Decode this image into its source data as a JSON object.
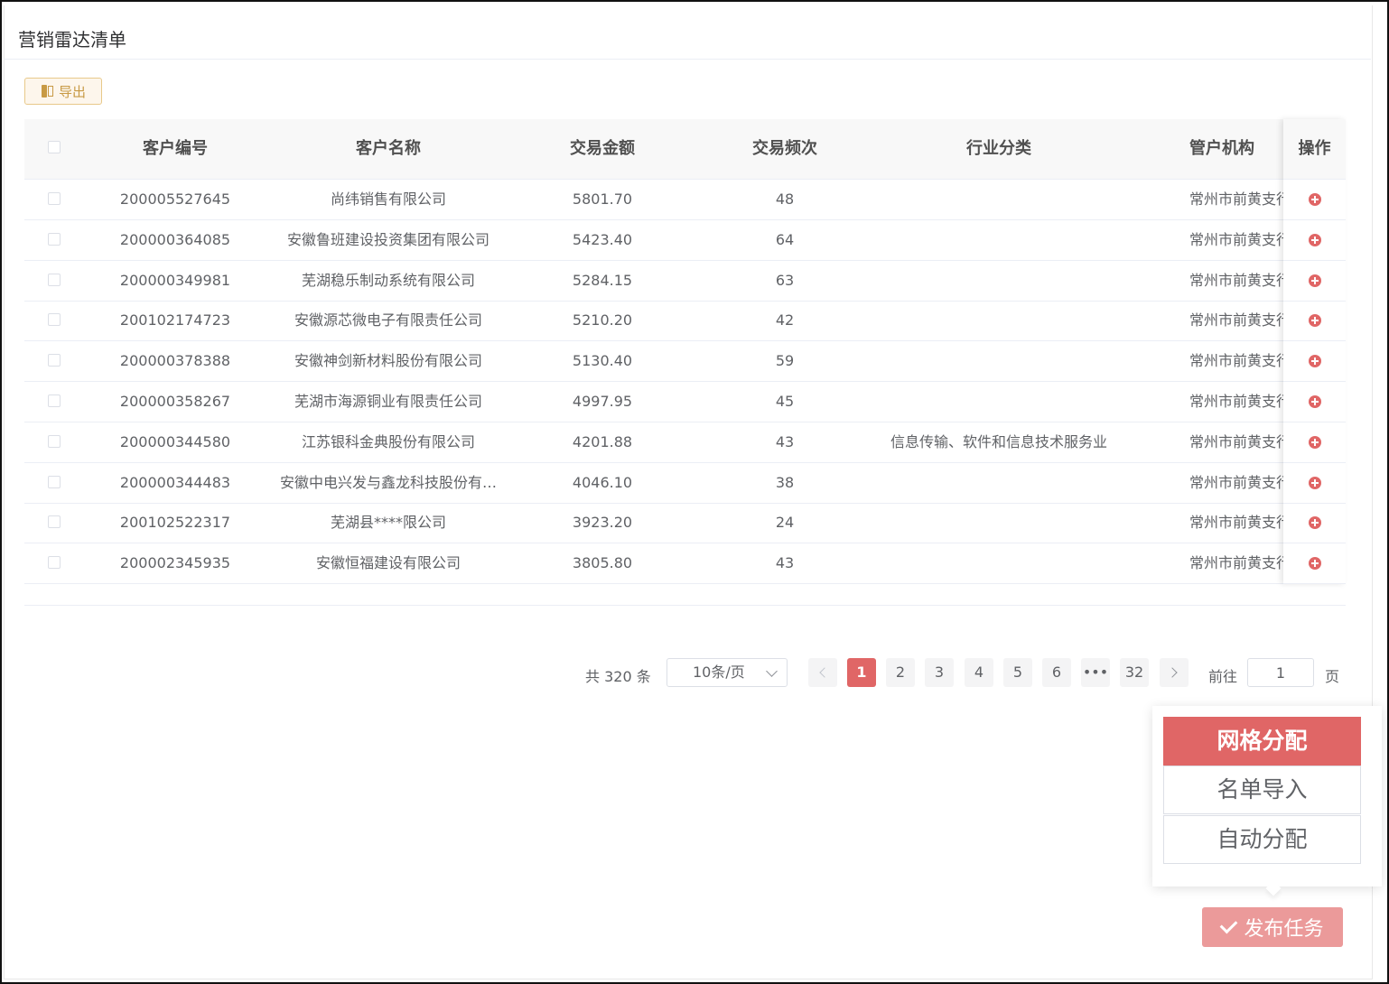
{
  "page": {
    "title": "营销雷达清单"
  },
  "toolbar": {
    "export_label": "导出"
  },
  "table": {
    "headers": {
      "customer_id": "客户编号",
      "customer_name": "客户名称",
      "amount": "交易金额",
      "frequency": "交易频次",
      "industry": "行业分类",
      "branch": "管户机构",
      "action": "操作"
    },
    "rows": [
      {
        "customer_id": "200005527645",
        "customer_name": "尚纬销售有限公司",
        "amount": "5801.70",
        "frequency": "48",
        "industry": "",
        "branch": "常州市前黄支行"
      },
      {
        "customer_id": "200000364085",
        "customer_name": "安徽鲁班建设投资集团有限公司",
        "amount": "5423.40",
        "frequency": "64",
        "industry": "",
        "branch": "常州市前黄支行"
      },
      {
        "customer_id": "200000349981",
        "customer_name": "芜湖稳乐制动系统有限公司",
        "amount": "5284.15",
        "frequency": "63",
        "industry": "",
        "branch": "常州市前黄支行"
      },
      {
        "customer_id": "200102174723",
        "customer_name": "安徽源芯微电子有限责任公司",
        "amount": "5210.20",
        "frequency": "42",
        "industry": "",
        "branch": "常州市前黄支行"
      },
      {
        "customer_id": "200000378388",
        "customer_name": "安徽神剑新材料股份有限公司",
        "amount": "5130.40",
        "frequency": "59",
        "industry": "",
        "branch": "常州市前黄支行"
      },
      {
        "customer_id": "200000358267",
        "customer_name": "芜湖市海源铜业有限责任公司",
        "amount": "4997.95",
        "frequency": "45",
        "industry": "",
        "branch": "常州市前黄支行"
      },
      {
        "customer_id": "200000344580",
        "customer_name": "江苏银科金典股份有限公司",
        "amount": "4201.88",
        "frequency": "43",
        "industry": "信息传输、软件和信息技术服务业",
        "branch": "常州市前黄支行"
      },
      {
        "customer_id": "200000344483",
        "customer_name": "安徽中电兴发与鑫龙科技股份有…",
        "amount": "4046.10",
        "frequency": "38",
        "industry": "",
        "branch": "常州市前黄支行"
      },
      {
        "customer_id": "200102522317",
        "customer_name": "芜湖县****限公司",
        "amount": "3923.20",
        "frequency": "24",
        "industry": "",
        "branch": "常州市前黄支行"
      },
      {
        "customer_id": "200002345935",
        "customer_name": "安徽恒福建设有限公司",
        "amount": "3805.80",
        "frequency": "43",
        "industry": "",
        "branch": "常州市前黄支行"
      }
    ]
  },
  "pagination": {
    "total_label": "共 320 条",
    "page_size": "10条/页",
    "pages": [
      "1",
      "2",
      "3",
      "4",
      "5",
      "6",
      "•••",
      "32"
    ],
    "current": "1",
    "goto_label": "前往",
    "goto_value": "1",
    "page_unit": "页"
  },
  "popover": {
    "items": [
      "网格分配",
      "名单导入",
      "自动分配"
    ]
  },
  "publish": {
    "label": "发布任务"
  },
  "colors": {
    "accent": "#e06666",
    "publish": "#eb9a9a",
    "export_border": "#e8c98a"
  }
}
